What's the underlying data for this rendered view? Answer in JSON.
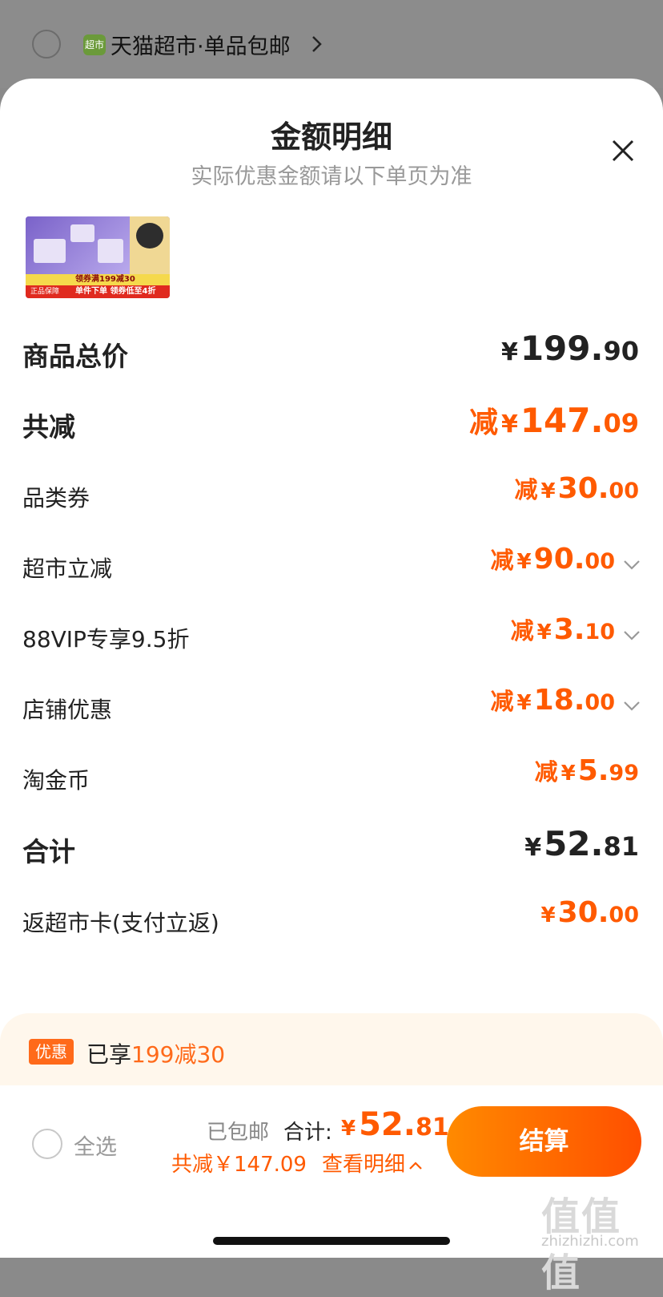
{
  "shop": {
    "icon_text": "超市",
    "name": "天猫超市·单品包邮"
  },
  "sheet": {
    "title": "金额明细",
    "subtitle": "实际优惠金额请以下单页为准"
  },
  "product_image": {
    "coupon_band": "领券满199减30",
    "guarantee": "正品保障",
    "promo_band": "单件下单 领券低至4折"
  },
  "rows": {
    "total_price": {
      "label": "商品总价",
      "currency": "¥",
      "int": "199.",
      "dec": "90"
    },
    "total_discount": {
      "label": "共减",
      "prefix": "减",
      "currency": "¥",
      "int": "147.",
      "dec": "09"
    },
    "category_coupon": {
      "label": "品类券",
      "prefix": "减",
      "currency": "¥",
      "int": "30.",
      "dec": "00"
    },
    "market_discount": {
      "label": "超市立减",
      "prefix": "减",
      "currency": "¥",
      "int": "90.",
      "dec": "00"
    },
    "vip_discount": {
      "label": "88VIP专享9.5折",
      "prefix": "减",
      "currency": "¥",
      "int": "3.",
      "dec": "10"
    },
    "store_discount": {
      "label": "店铺优惠",
      "prefix": "减",
      "currency": "¥",
      "int": "18.",
      "dec": "00"
    },
    "coins": {
      "label": "淘金币",
      "prefix": "减",
      "currency": "¥",
      "int": "5.",
      "dec": "99"
    },
    "subtotal": {
      "label": "合计",
      "currency": "¥",
      "int": "52.",
      "dec": "81"
    },
    "cashback": {
      "label": "返超市卡(支付立返)",
      "currency": "¥",
      "int": "30.",
      "dec": "00"
    }
  },
  "promo": {
    "tag": "优惠",
    "text_prefix": "已享",
    "text_highlight": "199减30"
  },
  "bottom_bar": {
    "select_all": "全选",
    "shipping": "已包邮",
    "total_label": "合计:",
    "total_currency": "¥",
    "total_int": "52.",
    "total_dec": "81",
    "savings": "共减￥147.09",
    "detail_link": "查看明细",
    "checkout": "结算"
  },
  "watermark": {
    "main": "值值值",
    "sub": "zhizhizhi.com"
  },
  "colors": {
    "accent": "#ff5a00",
    "promo_bg": "#fff7ec",
    "checkout_gradient_start": "#ff8a00",
    "checkout_gradient_end": "#ff4f00"
  }
}
